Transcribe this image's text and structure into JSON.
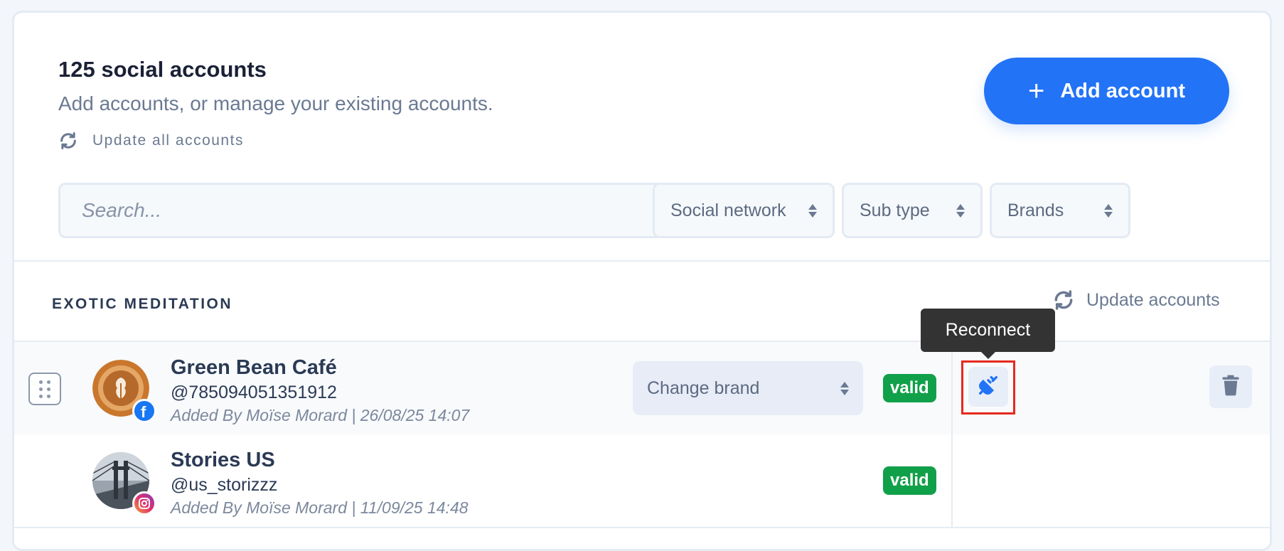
{
  "header": {
    "title": "125 social accounts",
    "subtitle": "Add accounts, or manage your existing accounts.",
    "update_all_label": "Update all accounts",
    "add_button_label": "Add account"
  },
  "filters": {
    "search_placeholder": "Search...",
    "social_network_label": "Social network",
    "sub_type_label": "Sub type",
    "brands_label": "Brands"
  },
  "group": {
    "title": "EXOTIC MEDITATION",
    "update_label": "Update accounts",
    "accounts": [
      {
        "name": "Green Bean Café",
        "handle": "@785094051351912",
        "added": "Added By Moïse Morard | 26/08/25 14:07",
        "network": "facebook",
        "brand_select_label": "Change brand",
        "status": "valid",
        "tooltip": "Reconnect"
      },
      {
        "name": "Stories US",
        "handle": "@us_storizzz",
        "added": "Added By Moïse Morard | 11/09/25 14:48",
        "network": "instagram",
        "status": "valid"
      }
    ]
  },
  "colors": {
    "accent": "#2273f6",
    "valid": "#11a04a",
    "facebook": "#1877f2",
    "highlight": "#e8281c"
  },
  "icons": [
    "sync-icon",
    "plus-icon",
    "updown-icon",
    "drag-handle-icon",
    "facebook-icon",
    "instagram-icon",
    "plug-icon",
    "trash-icon"
  ]
}
